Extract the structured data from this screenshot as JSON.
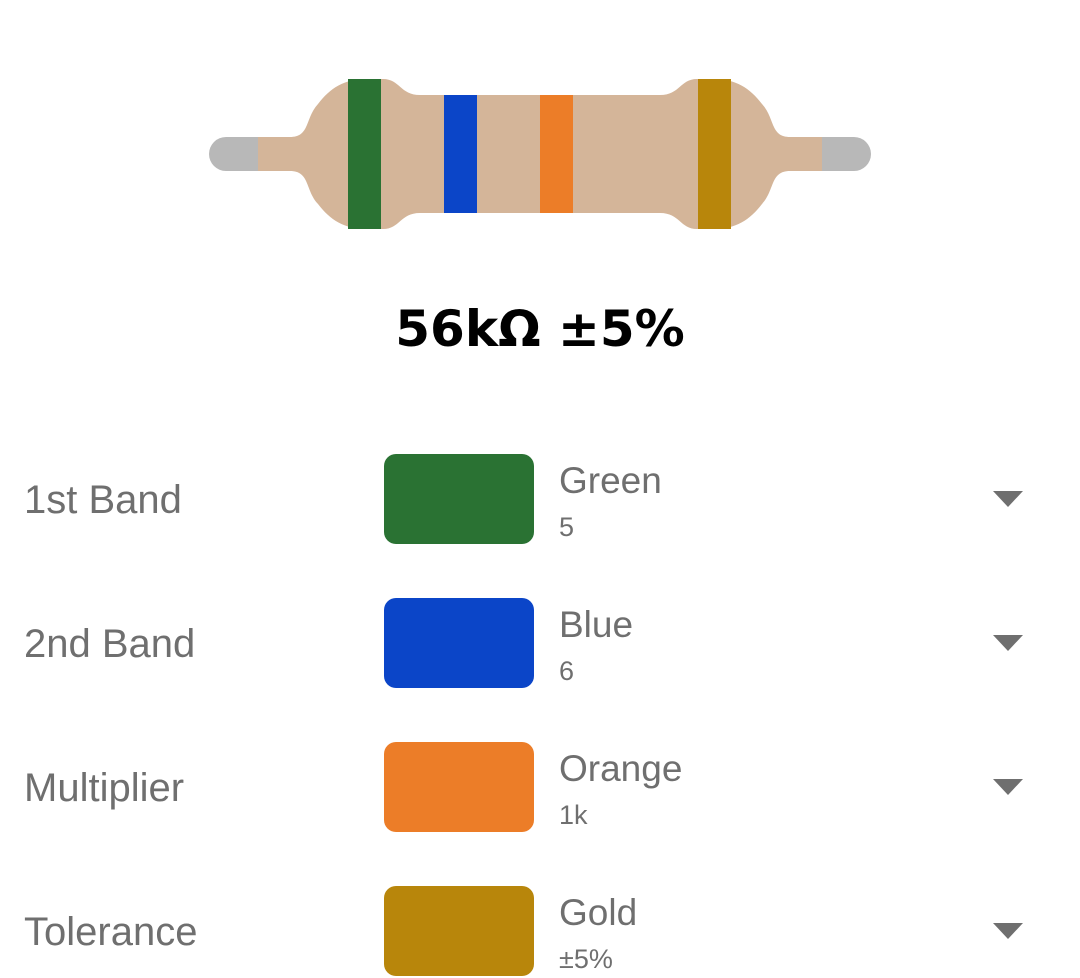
{
  "resistor": {
    "body_color": "#D4B599",
    "lead_color": "#B8B8B8",
    "bands": [
      "#2A7233",
      "#0B45C8",
      "#EC7D28",
      "#B8860B"
    ]
  },
  "result": {
    "value_text": "56kΩ ±5%"
  },
  "bands": [
    {
      "label": "1st Band",
      "color_name": "Green",
      "value": "5",
      "color": "#2A7233",
      "icon": "dropdown-arrow-icon"
    },
    {
      "label": "2nd Band",
      "color_name": "Blue",
      "value": "6",
      "color": "#0B45C8",
      "icon": "dropdown-arrow-icon"
    },
    {
      "label": "Multiplier",
      "color_name": "Orange",
      "value": "1k",
      "color": "#EC7D28",
      "icon": "dropdown-arrow-icon"
    },
    {
      "label": "Tolerance",
      "color_name": "Gold",
      "value": "±5%",
      "color": "#B8860B",
      "icon": "dropdown-arrow-icon"
    }
  ]
}
